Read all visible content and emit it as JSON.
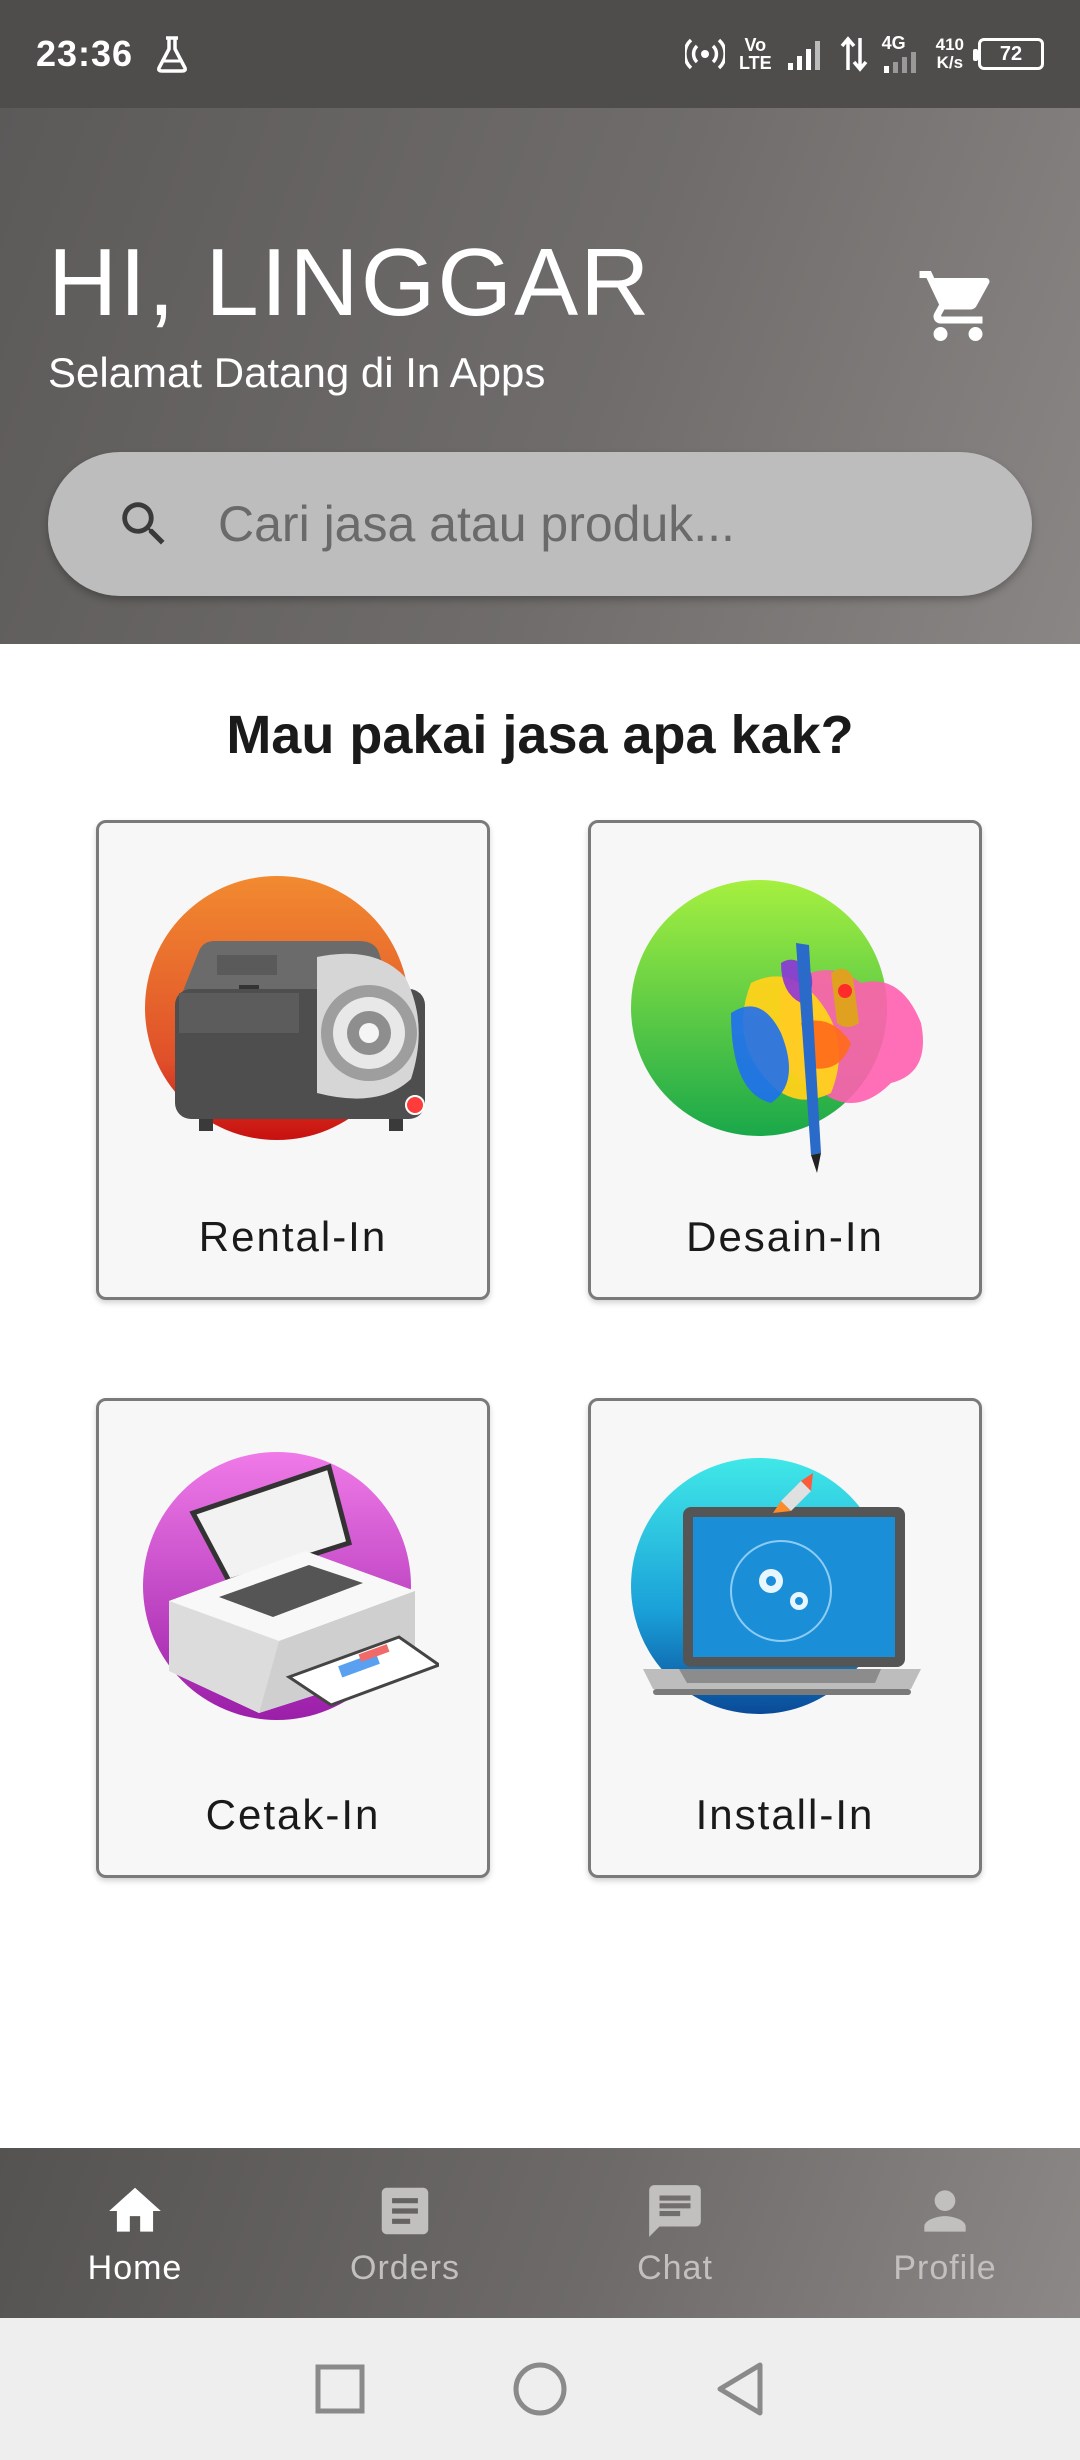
{
  "status_bar": {
    "time": "23:36",
    "network_top": "Vo",
    "network_bottom": "LTE",
    "network_gen": "4G",
    "speed_value": "410",
    "speed_unit": "K/s",
    "battery": "72"
  },
  "header": {
    "greeting": "HI, LINGGAR",
    "subtitle": "Selamat Datang di In Apps",
    "search_placeholder": "Cari jasa atau produk..."
  },
  "main": {
    "section_title": "Mau pakai jasa apa kak?",
    "services": [
      {
        "label": "Rental-In",
        "icon": "projector-icon"
      },
      {
        "label": "Desain-In",
        "icon": "design-brush-icon"
      },
      {
        "label": "Cetak-In",
        "icon": "printer-icon"
      },
      {
        "label": "Install-In",
        "icon": "laptop-icon"
      }
    ]
  },
  "bottom_nav": {
    "items": [
      {
        "label": "Home",
        "icon": "home-icon",
        "active": true
      },
      {
        "label": "Orders",
        "icon": "orders-icon",
        "active": false
      },
      {
        "label": "Chat",
        "icon": "chat-icon",
        "active": false
      },
      {
        "label": "Profile",
        "icon": "profile-icon",
        "active": false
      }
    ]
  },
  "colors": {
    "header_bg": "#5c5a59",
    "search_bg": "#bdbdbd",
    "nav_active": "#ffffff",
    "nav_inactive": "#c2c0bf",
    "card_border": "#7a7a7a"
  }
}
